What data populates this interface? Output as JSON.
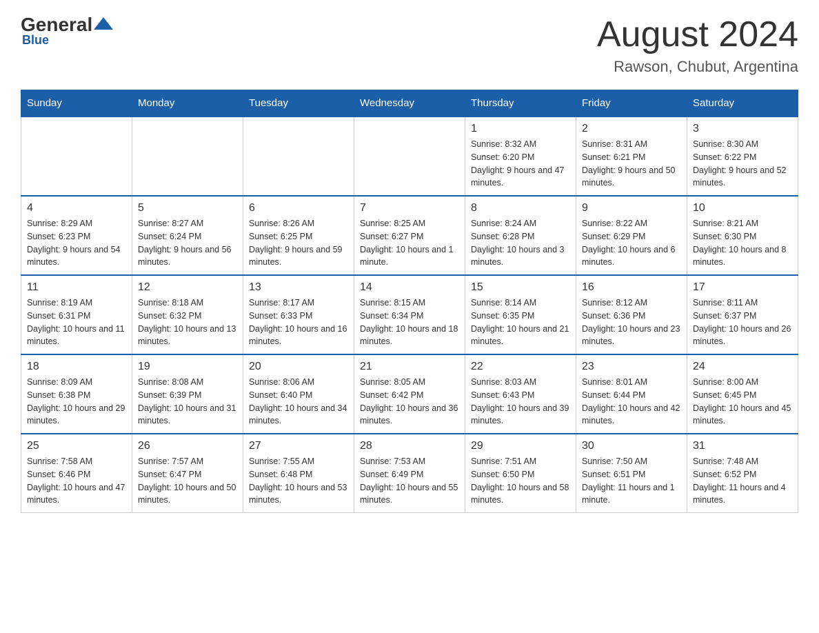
{
  "header": {
    "logo_general": "General",
    "logo_blue": "Blue",
    "month_title": "August 2024",
    "location": "Rawson, Chubut, Argentina"
  },
  "days_of_week": [
    "Sunday",
    "Monday",
    "Tuesday",
    "Wednesday",
    "Thursday",
    "Friday",
    "Saturday"
  ],
  "weeks": [
    [
      {
        "day": "",
        "info": ""
      },
      {
        "day": "",
        "info": ""
      },
      {
        "day": "",
        "info": ""
      },
      {
        "day": "",
        "info": ""
      },
      {
        "day": "1",
        "info": "Sunrise: 8:32 AM\nSunset: 6:20 PM\nDaylight: 9 hours and 47 minutes."
      },
      {
        "day": "2",
        "info": "Sunrise: 8:31 AM\nSunset: 6:21 PM\nDaylight: 9 hours and 50 minutes."
      },
      {
        "day": "3",
        "info": "Sunrise: 8:30 AM\nSunset: 6:22 PM\nDaylight: 9 hours and 52 minutes."
      }
    ],
    [
      {
        "day": "4",
        "info": "Sunrise: 8:29 AM\nSunset: 6:23 PM\nDaylight: 9 hours and 54 minutes."
      },
      {
        "day": "5",
        "info": "Sunrise: 8:27 AM\nSunset: 6:24 PM\nDaylight: 9 hours and 56 minutes."
      },
      {
        "day": "6",
        "info": "Sunrise: 8:26 AM\nSunset: 6:25 PM\nDaylight: 9 hours and 59 minutes."
      },
      {
        "day": "7",
        "info": "Sunrise: 8:25 AM\nSunset: 6:27 PM\nDaylight: 10 hours and 1 minute."
      },
      {
        "day": "8",
        "info": "Sunrise: 8:24 AM\nSunset: 6:28 PM\nDaylight: 10 hours and 3 minutes."
      },
      {
        "day": "9",
        "info": "Sunrise: 8:22 AM\nSunset: 6:29 PM\nDaylight: 10 hours and 6 minutes."
      },
      {
        "day": "10",
        "info": "Sunrise: 8:21 AM\nSunset: 6:30 PM\nDaylight: 10 hours and 8 minutes."
      }
    ],
    [
      {
        "day": "11",
        "info": "Sunrise: 8:19 AM\nSunset: 6:31 PM\nDaylight: 10 hours and 11 minutes."
      },
      {
        "day": "12",
        "info": "Sunrise: 8:18 AM\nSunset: 6:32 PM\nDaylight: 10 hours and 13 minutes."
      },
      {
        "day": "13",
        "info": "Sunrise: 8:17 AM\nSunset: 6:33 PM\nDaylight: 10 hours and 16 minutes."
      },
      {
        "day": "14",
        "info": "Sunrise: 8:15 AM\nSunset: 6:34 PM\nDaylight: 10 hours and 18 minutes."
      },
      {
        "day": "15",
        "info": "Sunrise: 8:14 AM\nSunset: 6:35 PM\nDaylight: 10 hours and 21 minutes."
      },
      {
        "day": "16",
        "info": "Sunrise: 8:12 AM\nSunset: 6:36 PM\nDaylight: 10 hours and 23 minutes."
      },
      {
        "day": "17",
        "info": "Sunrise: 8:11 AM\nSunset: 6:37 PM\nDaylight: 10 hours and 26 minutes."
      }
    ],
    [
      {
        "day": "18",
        "info": "Sunrise: 8:09 AM\nSunset: 6:38 PM\nDaylight: 10 hours and 29 minutes."
      },
      {
        "day": "19",
        "info": "Sunrise: 8:08 AM\nSunset: 6:39 PM\nDaylight: 10 hours and 31 minutes."
      },
      {
        "day": "20",
        "info": "Sunrise: 8:06 AM\nSunset: 6:40 PM\nDaylight: 10 hours and 34 minutes."
      },
      {
        "day": "21",
        "info": "Sunrise: 8:05 AM\nSunset: 6:42 PM\nDaylight: 10 hours and 36 minutes."
      },
      {
        "day": "22",
        "info": "Sunrise: 8:03 AM\nSunset: 6:43 PM\nDaylight: 10 hours and 39 minutes."
      },
      {
        "day": "23",
        "info": "Sunrise: 8:01 AM\nSunset: 6:44 PM\nDaylight: 10 hours and 42 minutes."
      },
      {
        "day": "24",
        "info": "Sunrise: 8:00 AM\nSunset: 6:45 PM\nDaylight: 10 hours and 45 minutes."
      }
    ],
    [
      {
        "day": "25",
        "info": "Sunrise: 7:58 AM\nSunset: 6:46 PM\nDaylight: 10 hours and 47 minutes."
      },
      {
        "day": "26",
        "info": "Sunrise: 7:57 AM\nSunset: 6:47 PM\nDaylight: 10 hours and 50 minutes."
      },
      {
        "day": "27",
        "info": "Sunrise: 7:55 AM\nSunset: 6:48 PM\nDaylight: 10 hours and 53 minutes."
      },
      {
        "day": "28",
        "info": "Sunrise: 7:53 AM\nSunset: 6:49 PM\nDaylight: 10 hours and 55 minutes."
      },
      {
        "day": "29",
        "info": "Sunrise: 7:51 AM\nSunset: 6:50 PM\nDaylight: 10 hours and 58 minutes."
      },
      {
        "day": "30",
        "info": "Sunrise: 7:50 AM\nSunset: 6:51 PM\nDaylight: 11 hours and 1 minute."
      },
      {
        "day": "31",
        "info": "Sunrise: 7:48 AM\nSunset: 6:52 PM\nDaylight: 11 hours and 4 minutes."
      }
    ]
  ]
}
